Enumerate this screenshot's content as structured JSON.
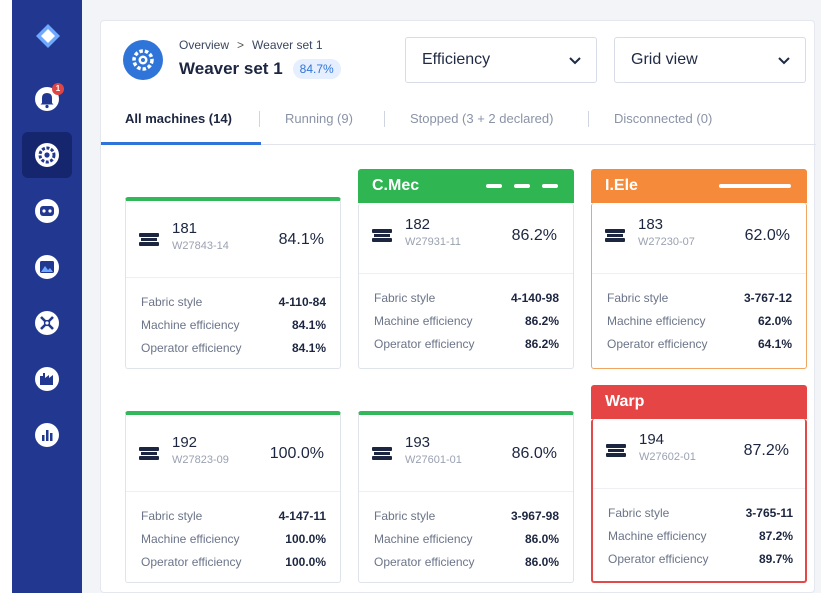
{
  "header": {
    "breadcrumb_root": "Overview",
    "breadcrumb_sep": ">",
    "breadcrumb_current": "Weaver set 1",
    "title": "Weaver set 1",
    "title_badge": "84.7%",
    "dropdown_metric": "Efficiency",
    "dropdown_view": "Grid view"
  },
  "sidebar": {
    "notification_count": "1",
    "items": [
      "logo-icon",
      "bell-icon",
      "gear-icon",
      "robot-icon",
      "image-icon",
      "tools-icon",
      "factory-icon",
      "chart-icon"
    ]
  },
  "tabs": [
    {
      "label": "All machines (14)"
    },
    {
      "label": "Running (9)"
    },
    {
      "label": "Stopped (3 + 2 declared)"
    },
    {
      "label": "Disconnected (0)"
    }
  ],
  "labels": {
    "fabric_style": "Fabric style",
    "machine_efficiency": "Machine efficiency",
    "operator_efficiency": "Operator efficiency"
  },
  "machines": [
    {
      "number": "181",
      "code": "W27843-14",
      "efficiency": "84.1%",
      "fabric_style": "4-110-84",
      "machine_eff": "84.1%",
      "operator_eff": "84.1%",
      "status": ""
    },
    {
      "number": "182",
      "code": "W27931-11",
      "efficiency": "86.2%",
      "fabric_style": "4-140-98",
      "machine_eff": "86.2%",
      "operator_eff": "86.2%",
      "status": "C.Mec"
    },
    {
      "number": "183",
      "code": "W27230-07",
      "efficiency": "62.0%",
      "fabric_style": "3-767-12",
      "machine_eff": "62.0%",
      "operator_eff": "64.1%",
      "status": "I.Ele"
    },
    {
      "number": "192",
      "code": "W27823-09",
      "efficiency": "100.0%",
      "fabric_style": "4-147-11",
      "machine_eff": "100.0%",
      "operator_eff": "100.0%",
      "status": ""
    },
    {
      "number": "193",
      "code": "W27601-01",
      "efficiency": "86.0%",
      "fabric_style": "3-967-98",
      "machine_eff": "86.0%",
      "operator_eff": "86.0%",
      "status": ""
    },
    {
      "number": "194",
      "code": "W27602-01",
      "efficiency": "87.2%",
      "fabric_style": "3-765-11",
      "machine_eff": "87.2%",
      "operator_eff": "89.7%",
      "status": "Warp"
    }
  ],
  "colors": {
    "sidebar": "#22378f",
    "accent": "#2f74d8",
    "running": "#2fb552",
    "warning": "#f58a3a",
    "stopped": "#e54545"
  }
}
